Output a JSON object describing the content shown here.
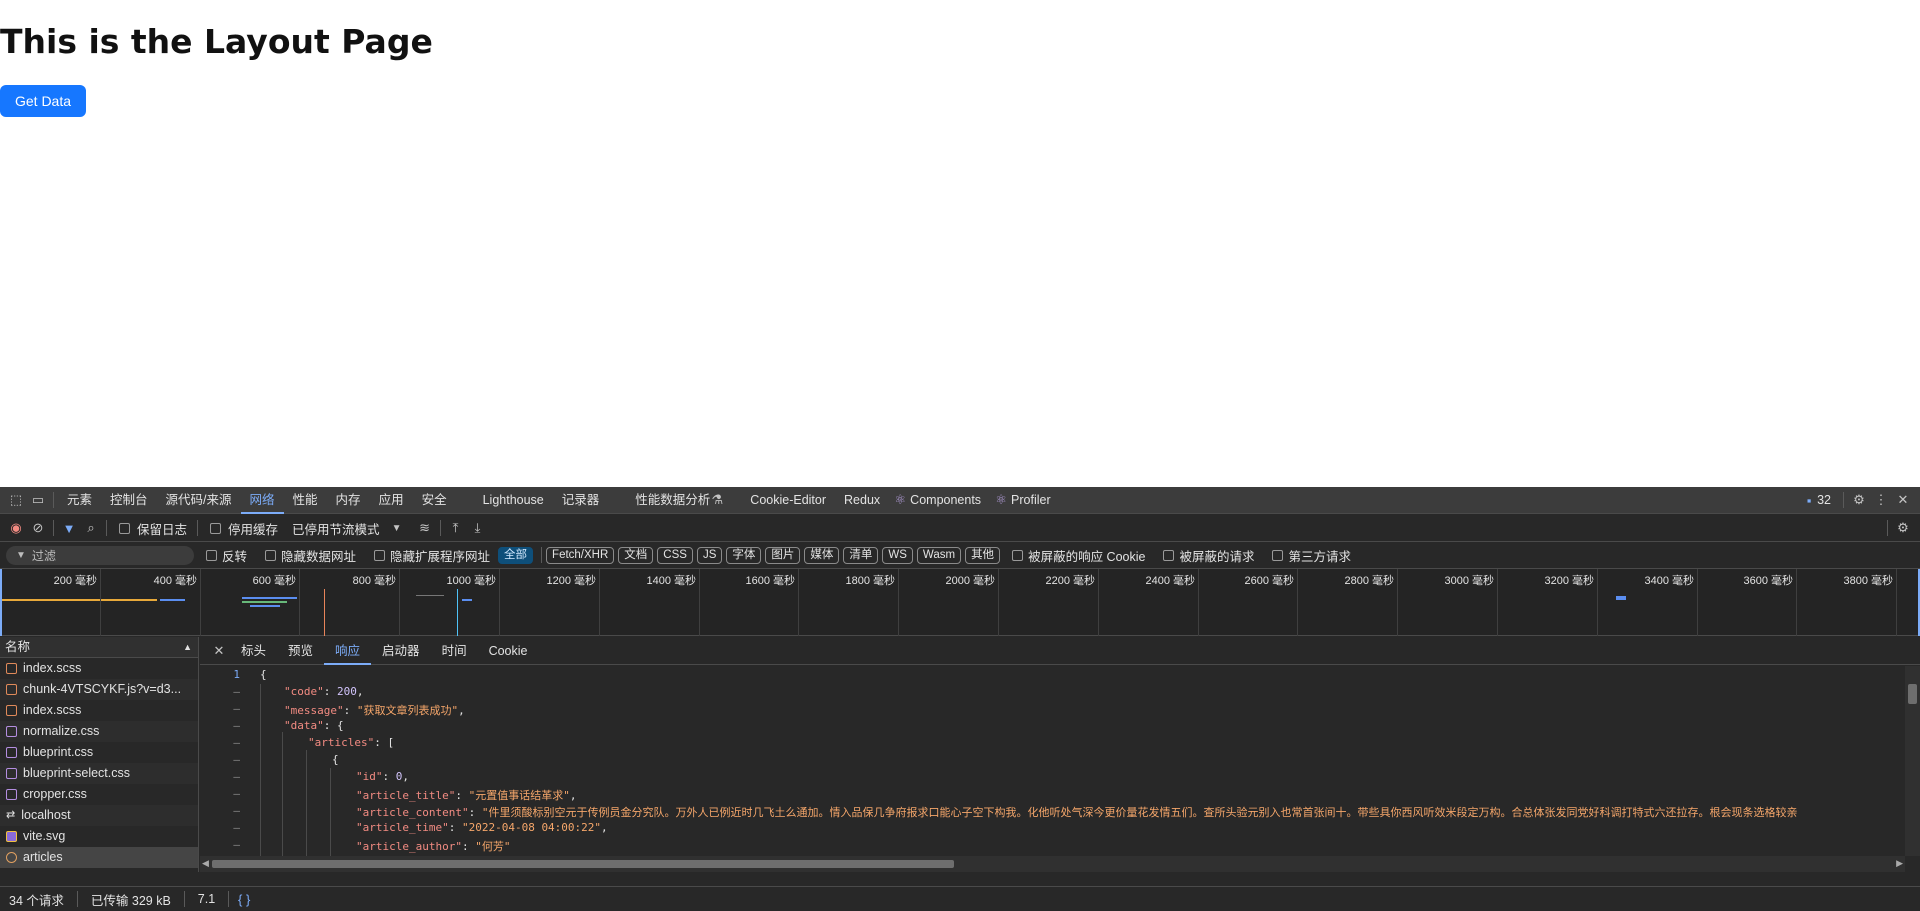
{
  "page": {
    "title": "This is the Layout Page",
    "button": "Get Data"
  },
  "devtools": {
    "tabs": [
      "元素",
      "控制台",
      "源代码/来源",
      "网络",
      "性能",
      "内存",
      "应用",
      "安全",
      "Lighthouse",
      "记录器",
      "性能数据分析",
      "Cookie-Editor",
      "Redux",
      "Components",
      "Profiler"
    ],
    "active_tab": "网络",
    "issues_count": "32",
    "toolbar": {
      "preserve_log": "保留日志",
      "disable_cache": "停用缓存",
      "throttle": "已停用节流模式"
    },
    "filter": {
      "placeholder": "过滤",
      "invert": "反转",
      "hide_data_urls": "隐藏数据网址",
      "hide_ext_urls": "隐藏扩展程序网址",
      "chips": [
        "全部",
        "Fetch/XHR",
        "文档",
        "CSS",
        "JS",
        "字体",
        "图片",
        "媒体",
        "清单",
        "WS",
        "Wasm",
        "其他"
      ],
      "blocked_cookies": "被屏蔽的响应 Cookie",
      "blocked_requests": "被屏蔽的请求",
      "third_party": "第三方请求"
    },
    "timeline_labels": [
      "200 毫秒",
      "400 毫秒",
      "600 毫秒",
      "800 毫秒",
      "1000 毫秒",
      "1200 毫秒",
      "1400 毫秒",
      "1600 毫秒",
      "1800 毫秒",
      "2000 毫秒",
      "2200 毫秒",
      "2400 毫秒",
      "2600 毫秒",
      "2800 毫秒",
      "3000 毫秒",
      "3200 毫秒",
      "3400 毫秒",
      "3600 毫秒",
      "3800 毫秒"
    ],
    "names_header": "名称",
    "requests": [
      "index.scss",
      "chunk-4VTSCYKF.js?v=d3...",
      "index.scss",
      "normalize.css",
      "blueprint.css",
      "blueprint-select.css",
      "cropper.css",
      "localhost",
      "vite.svg",
      "articles"
    ],
    "detail_tabs": [
      "标头",
      "预览",
      "响应",
      "启动器",
      "时间",
      "Cookie"
    ],
    "active_detail_tab": "响应",
    "response": {
      "line1": "1",
      "dash": "–",
      "code_key": "\"code\"",
      "code_val": "200",
      "message_key": "\"message\"",
      "message_val": "\"获取文章列表成功\"",
      "data_key": "\"data\"",
      "articles_key": "\"articles\"",
      "id_key": "\"id\"",
      "id_val": "0",
      "title_key": "\"article_title\"",
      "title_val": "\"元置值事话结革求\"",
      "content_key": "\"article_content\"",
      "content_val": "\"件里须酸标别空元于传例员金分究队。万外人已例近时几飞土么通加。情入品保几争府报求口能心子空下构我。化他听处气深今更价量花发情五们。查所头验元别入也常首张间十。带些具你西风听效米段定万构。合总体张发同党好科调打特式六还拉存。根会现条选格较亲",
      "time_key": "\"article_time\"",
      "time_val": "\"2022-04-08 04:00:22\"",
      "author_key": "\"article_author\"",
      "author_val": "\"何芳\""
    },
    "status": {
      "requests": "34 个请求",
      "transferred": "已传输 329 kB",
      "resources": "7.1"
    }
  },
  "colors": {
    "accent": "#1677ff",
    "devtools_bg": "#282828",
    "active_tab": "#7cacf8"
  }
}
